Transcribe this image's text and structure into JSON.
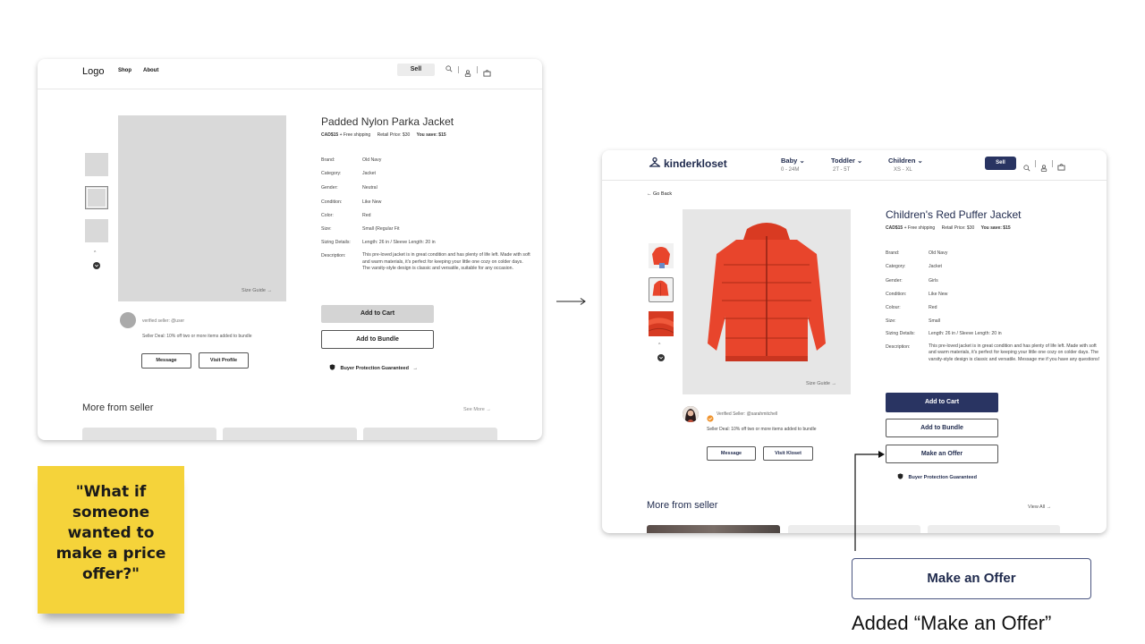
{
  "wireframe": {
    "header": {
      "logo": "Logo",
      "nav": [
        "Shop",
        "About"
      ],
      "sell_label": "Sell",
      "icons": [
        "search-icon",
        "user-icon",
        "basket-icon"
      ]
    },
    "product": {
      "title": "Padded Nylon Parka Jacket",
      "price": "CAD$15",
      "shipping": "+ Free shipping",
      "retail": "Retail Price: $30",
      "savings": "You save: $15",
      "size_guide": "Size Guide",
      "specs": [
        {
          "key": "Brand:",
          "value": "Old Navy"
        },
        {
          "key": "Category:",
          "value": "Jacket"
        },
        {
          "key": "Gender:",
          "value": "Neutral"
        },
        {
          "key": "Condition:",
          "value": "Like New"
        },
        {
          "key": "Color:",
          "value": "Red"
        },
        {
          "key": "Size:",
          "value": "Small (Regular Fit"
        },
        {
          "key": "Sizing Details:",
          "value": "Length: 26 in / Sleeve Length: 20 in"
        },
        {
          "key": "Description:",
          "value": "This pre-loved jacket is in great condition and has plenty of life left. Made with soft and warm materials, it's perfect for keeping your little one cozy on colder days. The varsity-style design is classic and versatile, suitable for any occasion."
        }
      ],
      "add_to_cart": "Add to Cart",
      "add_to_bundle": "Add to Bundle",
      "protection": "Buyer Protection Guaranteed"
    },
    "seller": {
      "verified": "verified seller: @user",
      "deal": "Seller Deal: 10% off two or more items added to bundle",
      "message": "Message",
      "visit": "Visit Profile"
    },
    "more": {
      "title": "More from seller",
      "link": "See More"
    }
  },
  "final": {
    "header": {
      "logo": "kinderkloset",
      "nav": [
        {
          "label": "Baby",
          "sub": "0 - 24M"
        },
        {
          "label": "Toddler",
          "sub": "2T - 5T"
        },
        {
          "label": "Children",
          "sub": "XS - XL"
        }
      ],
      "sell_label": "Sell",
      "icons": [
        "search-icon",
        "user-icon",
        "basket-icon"
      ]
    },
    "back": "Go Back",
    "product": {
      "title": "Children's Red Puffer Jacket",
      "price": "CAD$15",
      "shipping": "+ Free shipping",
      "retail": "Retail Price: $30",
      "savings": "You save: $15",
      "size_guide": "Size Guide",
      "specs": [
        {
          "key": "Brand:",
          "value": "Old Navy"
        },
        {
          "key": "Category:",
          "value": "Jacket"
        },
        {
          "key": "Gender:",
          "value": "Girls"
        },
        {
          "key": "Condition:",
          "value": "Like New"
        },
        {
          "key": "Colour:",
          "value": "Red"
        },
        {
          "key": "Size:",
          "value": "Small"
        },
        {
          "key": "Sizing Details:",
          "value": "Length: 26 in / Sleeve Length: 20 in"
        },
        {
          "key": "Description:",
          "value": "This pre-loved jacket is in great condition and has plenty of life left. Made with soft and warm materials, it's perfect for keeping your little one cozy on colder days. The varsity-style design is classic and versatile. Message me if you have any questions!"
        }
      ],
      "add_to_cart": "Add to Cart",
      "add_to_bundle": "Add to Bundle",
      "make_offer": "Make an Offer",
      "protection": "Buyer Protection Guaranteed"
    },
    "seller": {
      "verified": "Verified Seller: @sarahmitchell",
      "deal": "Seller Deal: 10% off two or more items added to bundle",
      "message": "Message",
      "visit": "Visit Kloset"
    },
    "more": {
      "title": "More from seller",
      "link": "View All"
    }
  },
  "annotations": {
    "sticky_note": "\"What if someone wanted to make a price offer?\"",
    "callout_button": "Make an Offer",
    "caption": "Added “Make an Offer”"
  },
  "colors": {
    "brand_navy": "#293462",
    "sticky": "#f5d33a",
    "jacket_red": "#e8452c",
    "verified_orange": "#f0942e"
  }
}
